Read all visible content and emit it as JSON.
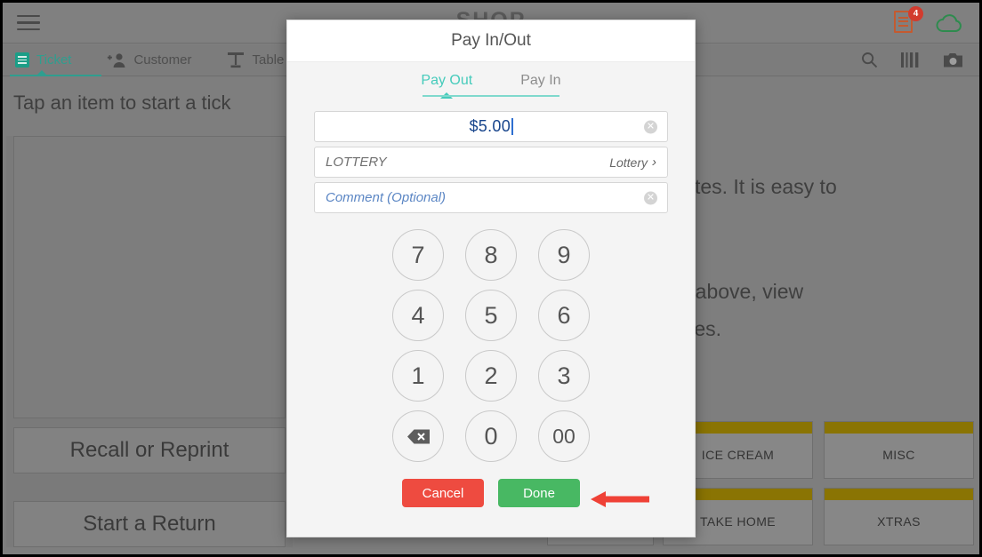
{
  "app": {
    "brand_logo": "SHOP",
    "hamburger": "menu-icon",
    "receipt_badge": "4",
    "hint_left": "Tap an item to start a tick",
    "hint_right_line1": "r Favorites. It is easy to",
    "hint_right_line2": "rch button above, view",
    "hint_right_line3": "l to Favorites."
  },
  "tabs": [
    {
      "label": "Ticket",
      "icon": "ticket-icon",
      "active": true
    },
    {
      "label": "Customer",
      "icon": "add-customer-icon",
      "active": false
    },
    {
      "label": "Table",
      "icon": "table-icon",
      "active": false
    }
  ],
  "toolbar_icons": [
    {
      "name": "search-icon"
    },
    {
      "name": "barcode-icon"
    },
    {
      "name": "camera-icon"
    }
  ],
  "left_buttons": [
    {
      "label": "Recall or Reprint"
    },
    {
      "label": "Start a Return"
    }
  ],
  "category_tiles": [
    {
      "label": "ICE CREAM"
    },
    {
      "label": "MISC"
    },
    {
      "label": "TAKE HOME"
    },
    {
      "label": "XTRAS"
    }
  ],
  "modal": {
    "title": "Pay In/Out",
    "tabs": [
      {
        "label": "Pay Out",
        "active": true
      },
      {
        "label": "Pay In",
        "active": false
      }
    ],
    "amount_value": "$5.00",
    "account_label": "LOTTERY",
    "account_value": "Lottery",
    "comment_placeholder": "Comment (Optional)",
    "keypad": [
      "7",
      "8",
      "9",
      "4",
      "5",
      "6",
      "1",
      "2",
      "3",
      "backspace",
      "0",
      "00"
    ],
    "cancel_label": "Cancel",
    "done_label": "Done"
  },
  "colors": {
    "accent_teal": "#45cbbb",
    "tab_teal": "#2f9e8f",
    "amount_blue": "#18458c",
    "cancel_red": "#ee4b40",
    "done_green": "#48b863",
    "badge_red": "#d23b2e",
    "tile_gold": "#8a7403",
    "arrow_red": "#ef4136"
  }
}
